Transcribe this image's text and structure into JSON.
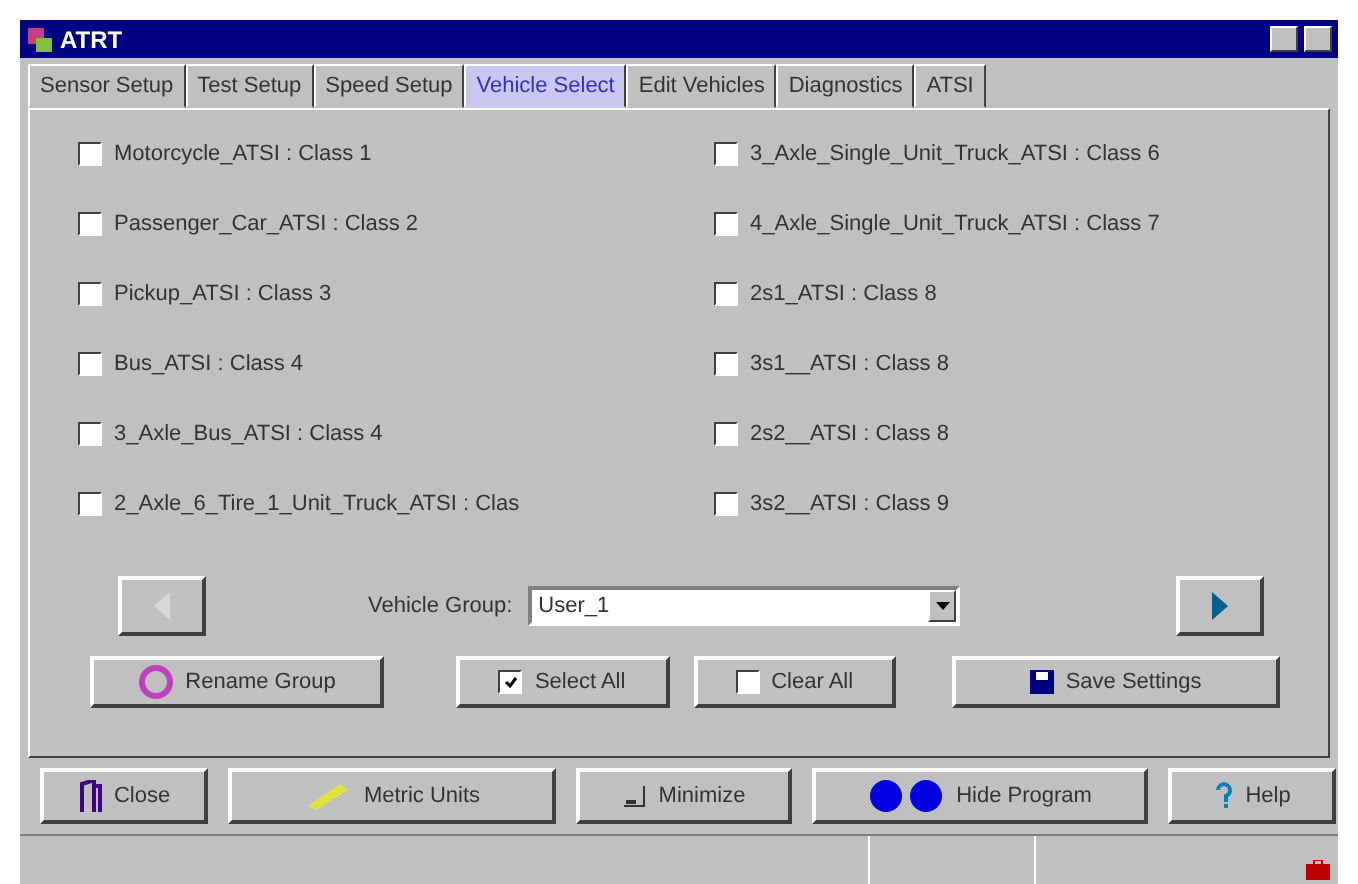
{
  "window": {
    "title": "ATRT"
  },
  "tabs": [
    {
      "label": "Sensor Setup",
      "selected": false
    },
    {
      "label": "Test Setup",
      "selected": false
    },
    {
      "label": "Speed Setup",
      "selected": false
    },
    {
      "label": "Vehicle Select",
      "selected": true
    },
    {
      "label": "Edit Vehicles",
      "selected": false
    },
    {
      "label": "Diagnostics",
      "selected": false
    },
    {
      "label": "ATSI",
      "selected": false
    }
  ],
  "vehicles": [
    {
      "label": "Motorcycle_ATSI : Class 1",
      "checked": false
    },
    {
      "label": "Passenger_Car_ATSI : Class 2",
      "checked": false
    },
    {
      "label": "Pickup_ATSI : Class 3",
      "checked": false
    },
    {
      "label": "Bus_ATSI : Class 4",
      "checked": false
    },
    {
      "label": "3_Axle_Bus_ATSI : Class 4",
      "checked": false
    },
    {
      "label": "2_Axle_6_Tire_1_Unit_Truck_ATSI : Clas",
      "checked": false
    },
    {
      "label": "3_Axle_Single_Unit_Truck_ATSI : Class 6",
      "checked": false
    },
    {
      "label": "4_Axle_Single_Unit_Truck_ATSI : Class 7",
      "checked": false
    },
    {
      "label": "2s1_ATSI : Class 8",
      "checked": false
    },
    {
      "label": "3s1__ATSI : Class 8",
      "checked": false
    },
    {
      "label": "2s2__ATSI : Class 8",
      "checked": false
    },
    {
      "label": "3s2__ATSI : Class 9",
      "checked": false
    }
  ],
  "navigation": {
    "previous_disabled": true,
    "next_disabled": false
  },
  "vehicle_group": {
    "label": "Vehicle Group:",
    "value": "User_1"
  },
  "group_buttons": [
    {
      "kind": "rename",
      "label": "Rename Group"
    },
    {
      "kind": "select",
      "label": "Select All"
    },
    {
      "kind": "clear",
      "label": "Clear All"
    },
    {
      "kind": "save",
      "label": "Save Settings"
    }
  ],
  "main_buttons": [
    {
      "kind": "close",
      "label": "Close"
    },
    {
      "kind": "units",
      "label": "Metric Units"
    },
    {
      "kind": "minimize",
      "label": "Minimize"
    },
    {
      "kind": "hide",
      "label": "Hide Program"
    },
    {
      "kind": "help",
      "label": "Help"
    }
  ]
}
